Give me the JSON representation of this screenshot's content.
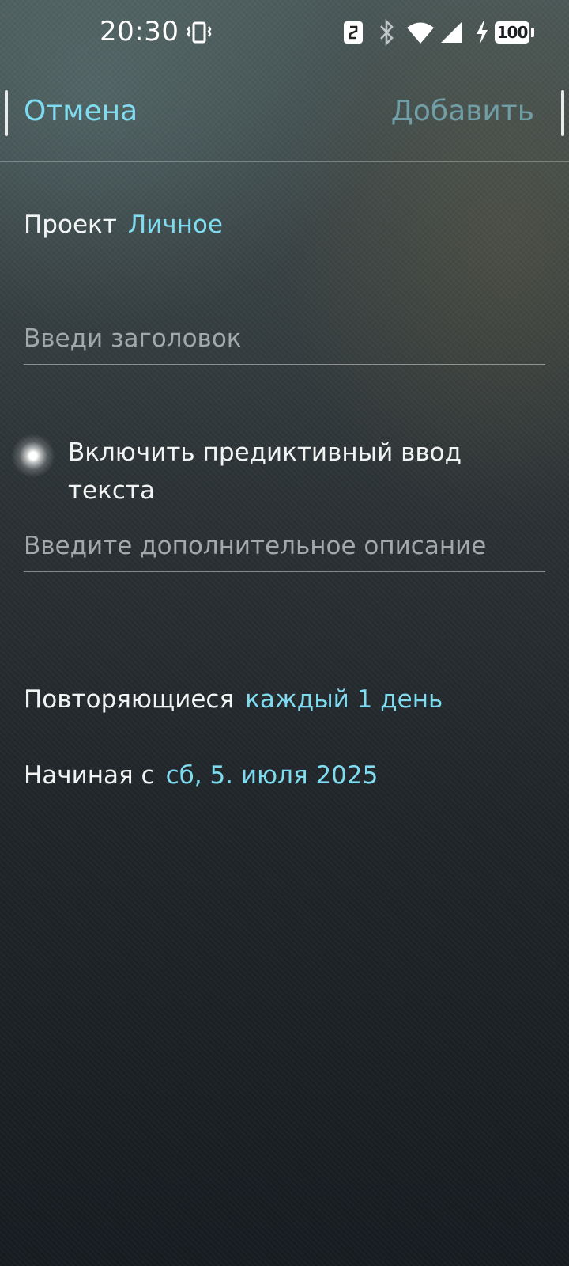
{
  "status_bar": {
    "time": "20:30",
    "battery": "100",
    "icons": [
      "vibrate-icon",
      "nfc-icon",
      "bluetooth-icon",
      "wifi-icon",
      "signal-icon",
      "charging-icon",
      "battery-icon"
    ]
  },
  "toolbar": {
    "cancel_label": "Отмена",
    "add_label": "Добавить"
  },
  "project": {
    "label": "Проект",
    "value": "Личное"
  },
  "title_field": {
    "placeholder": "Введи заголовок",
    "value": ""
  },
  "predictive": {
    "label": "Включить предиктивный ввод текста"
  },
  "description_field": {
    "placeholder": "Введите дополнительное описание",
    "value": ""
  },
  "repeat": {
    "label": "Повторяющиеся",
    "value": "каждый 1 день"
  },
  "start": {
    "label": "Начиная с",
    "value": "сб, 5. июля 2025"
  },
  "colors": {
    "accent": "#7fdcf0",
    "add_disabled": "#6f9ea6",
    "text": "#f2f4f4",
    "placeholder": "#a2a9ab"
  }
}
